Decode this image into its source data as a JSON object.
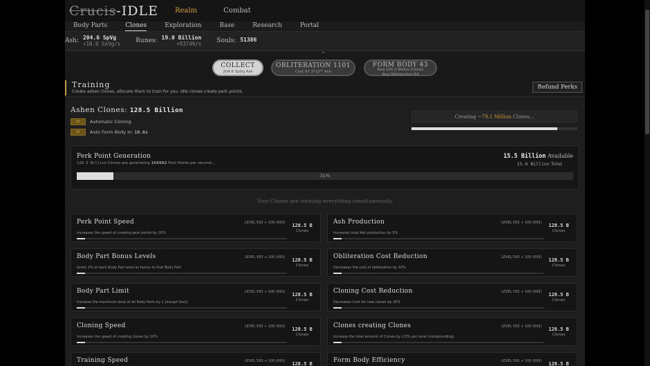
{
  "header": {
    "logo_strike": "Crucis",
    "logo_rest": "IDLE",
    "nav": [
      "Realm",
      "Combat"
    ]
  },
  "tabs": [
    "Body Parts",
    "Clones",
    "Exploration",
    "Base",
    "Research",
    "Portal"
  ],
  "resources": [
    {
      "label": "Ash:",
      "value": "204.6 SpVg",
      "rate": "+10.0 SxVg/s"
    },
    {
      "label": "Runes:",
      "value": "19.0 Billion",
      "rate": "+93749/s"
    },
    {
      "label": "Souls:",
      "value": "51386",
      "rate": ""
    }
  ],
  "actions": {
    "collect": {
      "title": "COLLECT",
      "sub": "204.6 SpVg Ash"
    },
    "obliteration": {
      "title": "OBLITERATION 1101",
      "sub": "Cost 97.3*10⁵⁰ Ash"
    },
    "form_body": {
      "title": "FORM BODY 43",
      "sub": "Req 100.0 Billion Clones",
      "sub2": "Req Obliteration 64"
    }
  },
  "section": {
    "title": "Training",
    "subtitle": "Create ashen clones, allocate them to train for you. Idle clones create perk points.",
    "refund_label": "Refund Perks"
  },
  "clones": {
    "title": "Ashen Clones:",
    "count": "128.5 Billion",
    "auto_label": "Automatic Cloning",
    "auto_form_label": "Auto Form Body in:",
    "auto_form_value": "18.6s",
    "creating_prefix": "Creating ~",
    "creating_value": "79.1 Million",
    "creating_suffix": "Clones...",
    "creating_progress": 0.88
  },
  "perk_gen": {
    "title": "Perk Point Generation",
    "desc_count": "128.5 Billion",
    "desc_mid": "Clones are generating",
    "desc_points": "166982",
    "desc_end": "Perk Points per second...",
    "available_value": "15.5 Billion",
    "available_label": "Available",
    "total_value": "15.6 Billion",
    "total_label": "Total",
    "progress_percent": 31,
    "progress_text": "31%"
  },
  "note": "Your Clones are training everything simultaneously.",
  "training_cards": [
    {
      "title": "Perk Point Speed",
      "level": "LEVEL 593 + 100 (693)",
      "desc": "Increases the speed of creating perk points by 20%",
      "clones": "128.5 B",
      "clones_label": "Clones",
      "progress": 0.04
    },
    {
      "title": "Ash Production",
      "level": "LEVEL 593 + 100 (693)",
      "desc": "Increases total Ash production by 5%",
      "clones": "128.5 B",
      "clones_label": "Clones",
      "progress": 0.04
    },
    {
      "title": "Body Part Bonus Levels",
      "level": "LEVEL 593 + 100 (693)",
      "desc": "Grant 2% of each Body Part level as bonus to that Body Part",
      "clones": "128.5 B",
      "clones_label": "Clones",
      "progress": 0.04
    },
    {
      "title": "Obliteration Cost Reduction",
      "level": "LEVEL 593 + 100 (693)",
      "desc": "Decreases the cost of obliteration by 10%",
      "clones": "128.5 B",
      "clones_label": "Clones",
      "progress": 0.04
    },
    {
      "title": "Body Part Limit",
      "level": "LEVEL 593 + 100 (693)",
      "desc": "Increase the maximum level of all Body Parts by 1 (except Soul)",
      "clones": "128.5 B",
      "clones_label": "Clones",
      "progress": 0.04
    },
    {
      "title": "Cloning Cost Reduction",
      "level": "LEVEL 593 + 100 (693)",
      "desc": "Decreases Cost for new clones by 20%",
      "clones": "128.5 B",
      "clones_label": "Clones",
      "progress": 0.04
    },
    {
      "title": "Cloning Speed",
      "level": "LEVEL 593 + 100 (693)",
      "desc": "Increases the speed of creating clones by 10%",
      "clones": "128.5 B",
      "clones_label": "Clones",
      "progress": 0.04
    },
    {
      "title": "Clones creating Clones",
      "level": "LEVEL 593 + 100 (693)",
      "desc": "Increase the total amount of Clones by 2.5% per level (compounding)",
      "clones": "128.5 B",
      "clones_label": "Clones",
      "progress": 0.04
    },
    {
      "title": "Training Speed",
      "level": "LEVEL 593 + 100 (693)",
      "desc": "",
      "clones": "128.5 B",
      "clones_label": "",
      "progress": 0.04
    },
    {
      "title": "Form Body Efficiency",
      "level": "LEVEL 593 + 100 (693)",
      "desc": "",
      "clones": "128.5 B",
      "clones_label": "",
      "progress": 0.04
    }
  ]
}
